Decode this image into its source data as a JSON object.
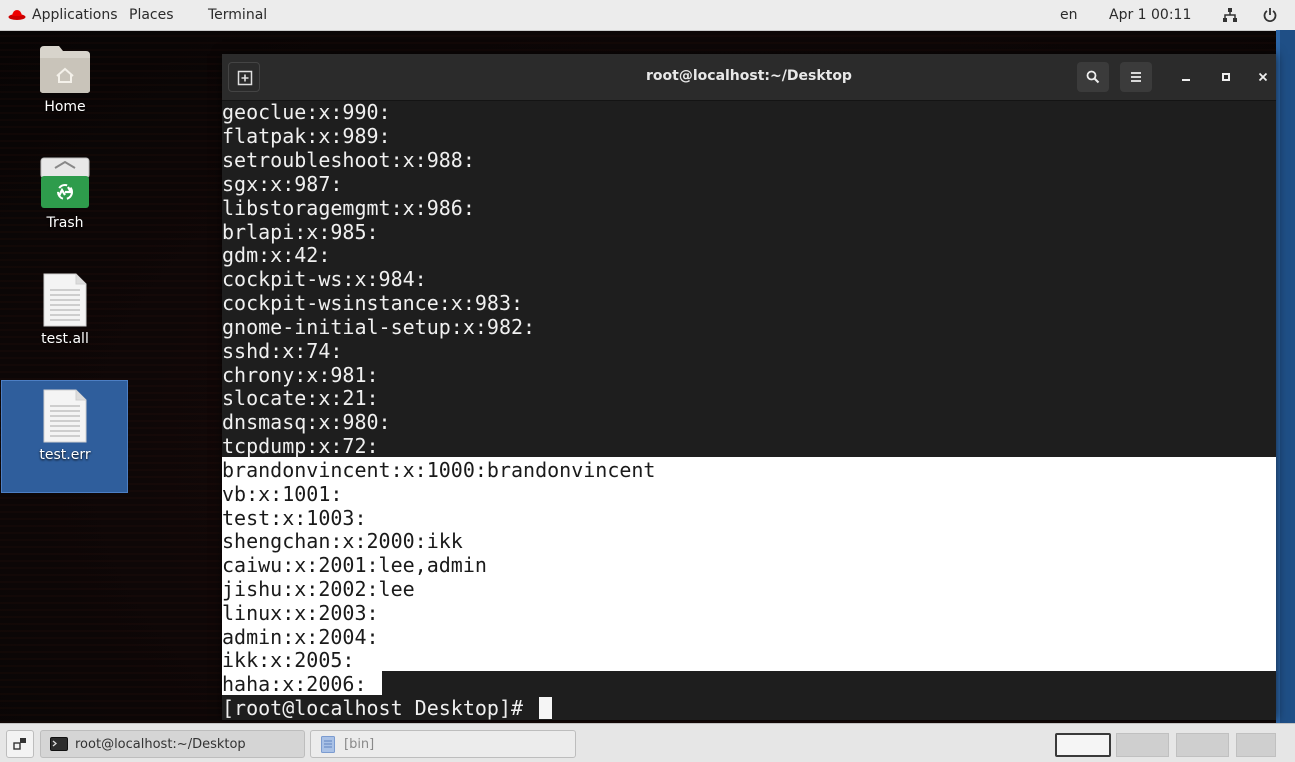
{
  "topbar": {
    "applications": "Applications",
    "places": "Places",
    "terminal": "Terminal",
    "lang": "en",
    "clock": "Apr 1 00:11"
  },
  "desktop": {
    "icons": [
      {
        "label": "Home",
        "icon": "folder-home-icon"
      },
      {
        "label": "Trash",
        "icon": "trash-icon"
      },
      {
        "label": "test.all",
        "icon": "text-file-icon"
      },
      {
        "label": "test.err",
        "icon": "text-file-icon"
      }
    ]
  },
  "terminal": {
    "title": "root@localhost:~/Desktop",
    "lines": [
      "geoclue:x:990:",
      "flatpak:x:989:",
      "setroubleshoot:x:988:",
      "sgx:x:987:",
      "libstoragemgmt:x:986:",
      "brlapi:x:985:",
      "gdm:x:42:",
      "cockpit-ws:x:984:",
      "cockpit-wsinstance:x:983:",
      "gnome-initial-setup:x:982:",
      "sshd:x:74:",
      "chrony:x:981:",
      "slocate:x:21:",
      "dnsmasq:x:980:",
      "tcpdump:x:72:",
      "brandonvincent:x:1000:brandonvincent",
      "vb:x:1001:",
      "test:x:1003:",
      "shengchan:x:2000:ikk",
      "caiwu:x:2001:lee,admin",
      "jishu:x:2002:lee",
      "linux:x:2003:",
      "admin:x:2004:",
      "ikk:x:2005:",
      "haha:x:2006:"
    ],
    "prompt": "[root@localhost Desktop]# "
  },
  "taskbar": {
    "task_terminal": "root@localhost:~/Desktop",
    "task_bin": "[bin]"
  },
  "colors": {
    "selection_bg": "#ffffff",
    "terminal_bg": "#1e1e1e",
    "selected_icon_bg": "#2f5e9c"
  }
}
